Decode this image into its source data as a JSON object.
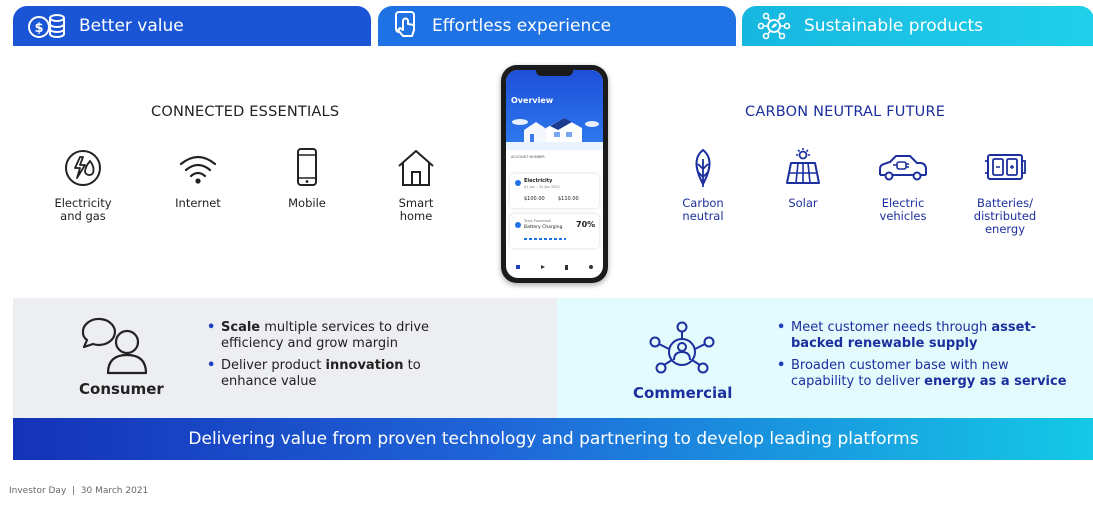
{
  "tabs": [
    {
      "label": "Better value",
      "icon": "money-stack-icon"
    },
    {
      "label": "Effortless experience",
      "icon": "tap-hand-icon"
    },
    {
      "label": "Sustainable products",
      "icon": "eco-network-icon"
    }
  ],
  "connected": {
    "title": "CONNECTED ESSENTIALS",
    "items": [
      {
        "label": "Electricity\nand gas",
        "icon": "electricity-gas-icon"
      },
      {
        "label": "Internet",
        "icon": "wifi-icon"
      },
      {
        "label": "Mobile",
        "icon": "mobile-phone-icon"
      },
      {
        "label": "Smart\nhome",
        "icon": "smart-home-icon"
      }
    ]
  },
  "carbon": {
    "title": "CARBON NEUTRAL FUTURE",
    "items": [
      {
        "label": "Carbon\nneutral",
        "icon": "leaf-icon"
      },
      {
        "label": "Solar",
        "icon": "solar-panel-icon"
      },
      {
        "label": "Electric\nvehicles",
        "icon": "electric-car-icon"
      },
      {
        "label": "Batteries/\ndistributed\nenergy",
        "icon": "battery-icon"
      }
    ]
  },
  "phone": {
    "screen_title": "Overview",
    "account_label": "ACCOUNT NUMBER",
    "card1_title": "Electricity",
    "card1_sub": "01 Jan – 31 Jan 2021",
    "card1_value1": "$100.00",
    "card1_value2": "$110.00",
    "card2_title": "Tesla Powerwall",
    "card2_sub": "Battery Charging",
    "card2_percent": "70%"
  },
  "consumer": {
    "label": "Consumer",
    "bullets": [
      {
        "bold": "Scale",
        "text": " multiple services to drive efficiency and grow margin"
      },
      {
        "pre": "Deliver product ",
        "bold": "innovation",
        "text": " to enhance value"
      }
    ]
  },
  "commercial": {
    "label": "Commercial",
    "bullets": [
      {
        "pre": "Meet customer needs through ",
        "bold": "asset-backed renewable supply",
        "text": ""
      },
      {
        "pre": "Broaden customer base with new capability to deliver ",
        "bold": "energy as a service",
        "text": ""
      }
    ]
  },
  "banner": "Delivering value from proven technology and partnering to develop leading platforms",
  "footer": "Investor Day  |  30 March 2021",
  "colors": {
    "accent_blue": "#1a55d6",
    "navy_text": "#1c2f9e",
    "cyan": "#17c3e3"
  }
}
